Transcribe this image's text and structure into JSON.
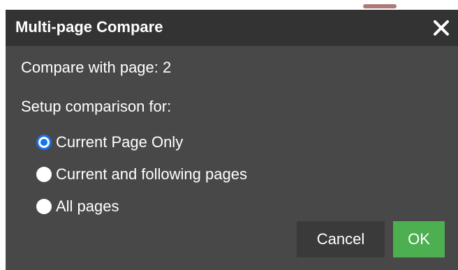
{
  "dialog": {
    "title": "Multi-page Compare",
    "close_icon": "close-icon",
    "compare_label": "Compare with page: 2",
    "setup_label": "Setup comparison for:",
    "options": [
      {
        "label": "Current Page Only",
        "selected": true
      },
      {
        "label": "Current and following pages",
        "selected": false
      },
      {
        "label": "All pages",
        "selected": false
      }
    ],
    "cancel_label": "Cancel",
    "ok_label": "OK"
  },
  "colors": {
    "dialog_bg": "#484848",
    "titlebar_bg": "#333333",
    "radio_selected": "#1a73e8",
    "ok_button": "#4caf50",
    "cancel_button": "#3a3a3a",
    "text": "#ffffff"
  }
}
